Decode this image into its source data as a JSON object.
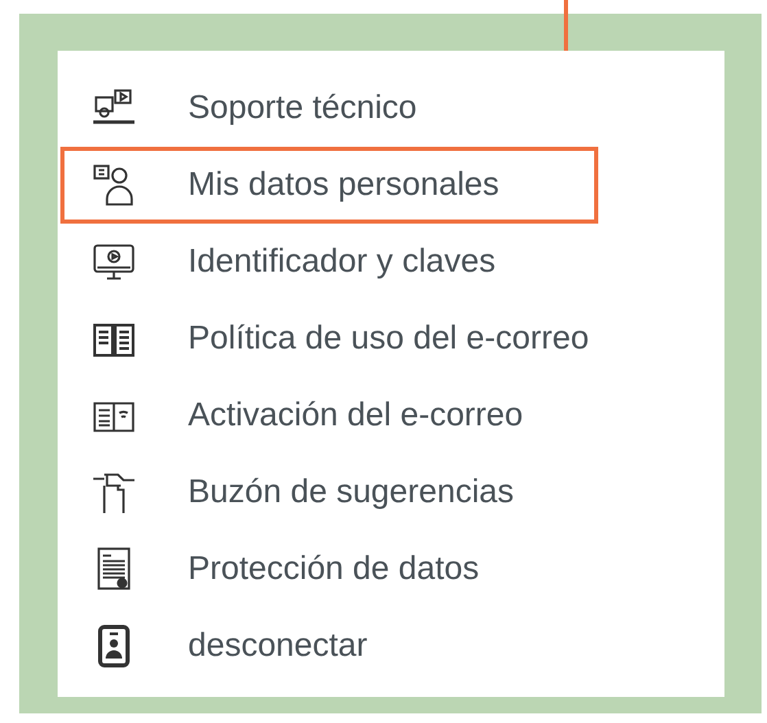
{
  "menu": [
    {
      "label": "Soporte técnico",
      "selected": false
    },
    {
      "label": "Mis datos personales",
      "selected": true
    },
    {
      "label": "Identificador y claves",
      "selected": false
    },
    {
      "label": "Política de uso del e-correo",
      "selected": false
    },
    {
      "label": "Activación del e-correo",
      "selected": false
    },
    {
      "label": "Buzón de sugerencias",
      "selected": false
    },
    {
      "label": "Protección de datos",
      "selected": false
    },
    {
      "label": "desconectar",
      "selected": false
    }
  ]
}
